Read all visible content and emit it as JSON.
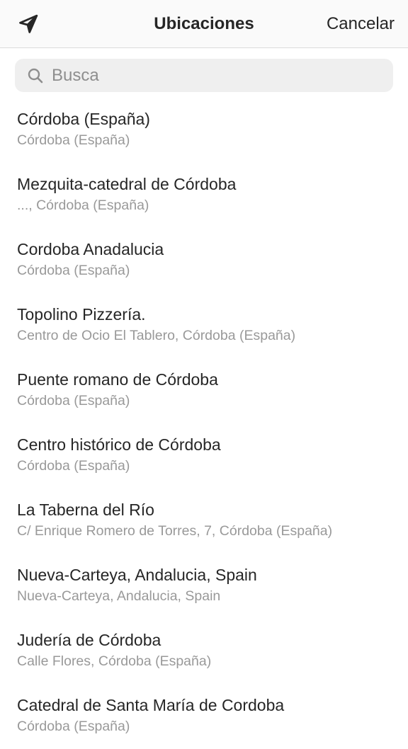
{
  "header": {
    "title": "Ubicaciones",
    "cancel_label": "Cancelar",
    "location_icon": "location-arrow-icon"
  },
  "search": {
    "placeholder": "Busca",
    "value": "",
    "icon": "search-icon"
  },
  "locations": [
    {
      "name": "Córdoba (España)",
      "subtitle": "Córdoba (España)"
    },
    {
      "name": "Mezquita-catedral de Córdoba",
      "subtitle": "..., Córdoba (España)"
    },
    {
      "name": "Cordoba Anadalucia",
      "subtitle": "Córdoba (España)"
    },
    {
      "name": "Topolino Pizzería.",
      "subtitle": "Centro de Ocio El Tablero, Córdoba (España)"
    },
    {
      "name": "Puente romano de Córdoba",
      "subtitle": "Córdoba (España)"
    },
    {
      "name": "Centro histórico de Córdoba",
      "subtitle": "Córdoba (España)"
    },
    {
      "name": "La Taberna del Río",
      "subtitle": "C/ Enrique Romero de Torres, 7, Córdoba (España)"
    },
    {
      "name": "Nueva-Carteya, Andalucia, Spain",
      "subtitle": "Nueva-Carteya, Andalucia, Spain"
    },
    {
      "name": "Judería de Córdoba",
      "subtitle": "Calle Flores, Córdoba (España)"
    },
    {
      "name": "Catedral de Santa María de Cordoba",
      "subtitle": "Córdoba (España)"
    }
  ]
}
